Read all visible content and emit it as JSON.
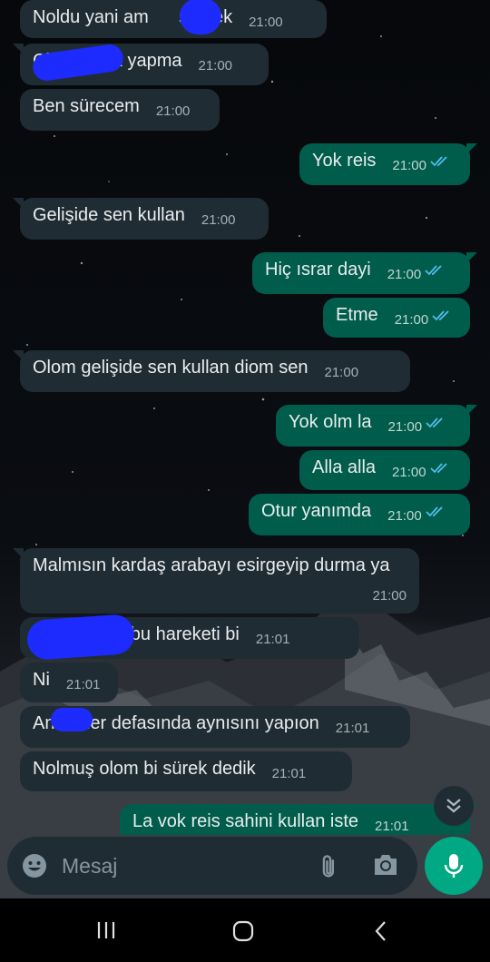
{
  "messages": [
    {
      "dir": "in",
      "text": "Noldu yani am      sürsek",
      "time": "21:00"
    },
    {
      "dir": "in",
      "text": "Ci        cılık yapma",
      "time": "21:00"
    },
    {
      "dir": "in",
      "text": "Ben sürecem",
      "time": "21:00"
    },
    {
      "dir": "out",
      "text": "Yok reis",
      "time": "21:00"
    },
    {
      "dir": "in",
      "text": "Gelişide sen kullan",
      "time": "21:00"
    },
    {
      "dir": "out",
      "text": "Hiç ısrar dayi",
      "time": "21:00"
    },
    {
      "dir": "out",
      "text": "Etme",
      "time": "21:00"
    },
    {
      "dir": "in",
      "text": "Olom gelişide sen kullan diom sen",
      "time": "21:00"
    },
    {
      "dir": "out",
      "text": "Yok olm la",
      "time": "21:00"
    },
    {
      "dir": "out",
      "text": "Alla alla",
      "time": "21:00"
    },
    {
      "dir": "out",
      "text": "Otur yanımda",
      "time": "21:00"
    },
    {
      "dir": "in",
      "text": "Malmısın kardaş arabayı esirgeyip durma ya",
      "time": "21:00"
    },
    {
      "dir": "in",
      "text": "          şimdi bu hareketi bi",
      "time": "21:01"
    },
    {
      "dir": "in",
      "text": "Ni",
      "time": "21:01"
    },
    {
      "dir": "in",
      "text": "An     ner defasında aynısını yapıon",
      "time": "21:01"
    },
    {
      "dir": "in",
      "text": "Nolmuş olom bi sürek dedik",
      "time": "21:01"
    },
    {
      "dir": "out",
      "text": "La vok reis sahini kullan iste",
      "time": "21:01"
    }
  ],
  "input": {
    "placeholder": "Mesaj"
  },
  "icons": {
    "emoji": "emoji-icon",
    "attach": "paperclip-icon",
    "camera": "camera-icon",
    "mic": "microphone-icon",
    "scroll": "double-chevron-down-icon",
    "read_receipt": "double-check-icon"
  },
  "colors": {
    "incoming": "#202c33",
    "outgoing": "#005c4b",
    "accent": "#00a884",
    "tick": "#53bdeb"
  }
}
